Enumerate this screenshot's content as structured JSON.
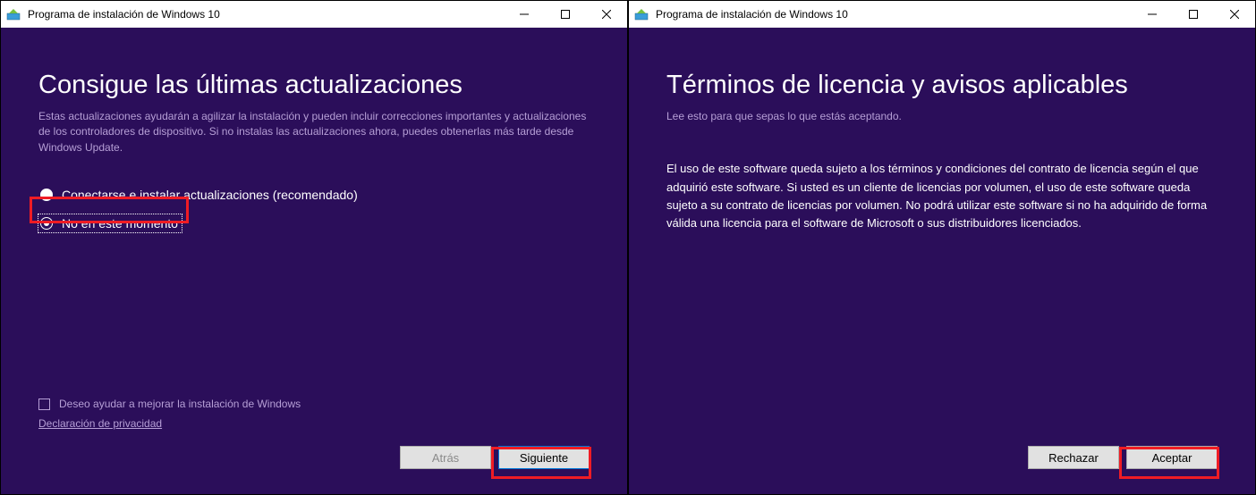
{
  "left": {
    "titlebar": {
      "title": "Programa de instalación de Windows 10"
    },
    "heading": "Consigue las últimas actualizaciones",
    "sub": "Estas actualizaciones ayudarán a agilizar la instalación y pueden incluir correcciones importantes y actualizaciones de los controladores de dispositivo. Si no instalas las actualizaciones ahora, puedes obtenerlas más tarde desde Windows Update.",
    "options": {
      "opt1": "Conectarse e instalar actualizaciones (recomendado)",
      "opt2": "No en este momento"
    },
    "help_checkbox": "Deseo ayudar a mejorar la instalación de Windows",
    "privacy_link": "Declaración de privacidad",
    "buttons": {
      "back": "Atrás",
      "next": "Siguiente"
    }
  },
  "right": {
    "titlebar": {
      "title": "Programa de instalación de Windows 10"
    },
    "heading": "Términos de licencia y avisos aplicables",
    "sub": "Lee esto para que sepas lo que estás aceptando.",
    "license_text": "El uso de este software queda sujeto a los términos y condiciones del contrato de licencia según el que adquirió este software. Si usted es un cliente de licencias por volumen, el uso de este software queda sujeto a su contrato de licencias por volumen. No podrá utilizar este software si no ha adquirido de forma válida una licencia para el software de Microsoft o sus distribuidores licenciados.",
    "buttons": {
      "reject": "Rechazar",
      "accept": "Aceptar"
    }
  }
}
